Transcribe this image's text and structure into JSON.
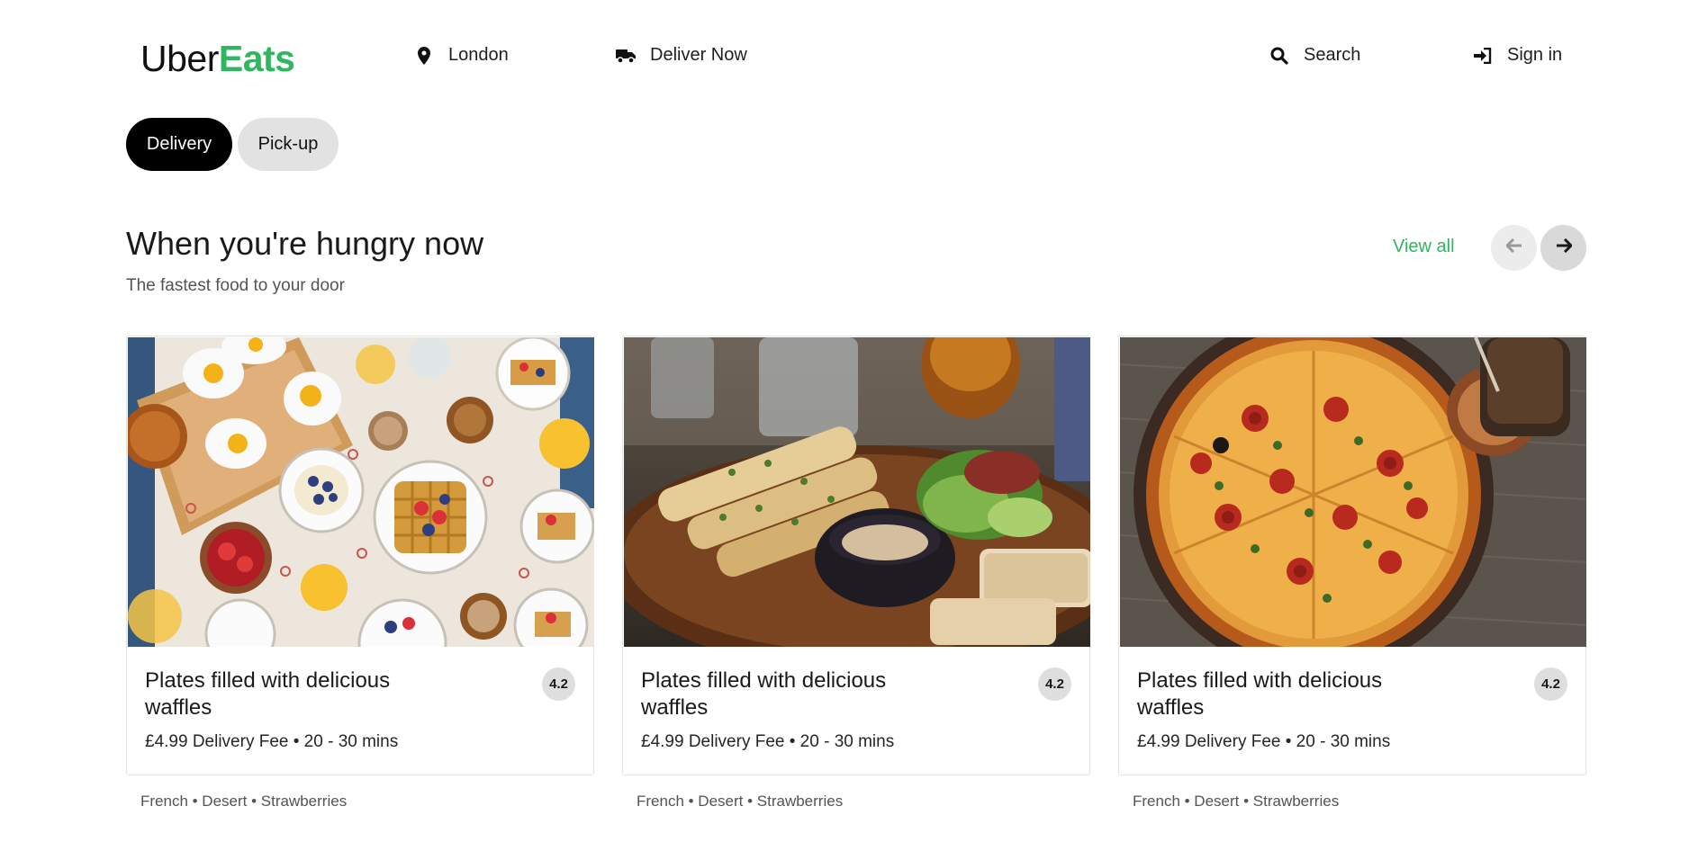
{
  "brand": {
    "part1": "Uber",
    "part2": "Eats",
    "accent_color": "#2fb65f"
  },
  "nav": {
    "location": {
      "label": "London",
      "icon": "map-pin-icon"
    },
    "deliver": {
      "label": "Deliver Now",
      "icon": "truck-icon"
    },
    "search": {
      "label": "Search",
      "icon": "search-icon"
    },
    "signin": {
      "label": "Sign in",
      "icon": "sign-in-icon"
    }
  },
  "toggle": {
    "delivery": "Delivery",
    "pickup": "Pick-up",
    "selected": "Delivery"
  },
  "section": {
    "title": "When you're hungry now",
    "subtitle": "The fastest food to your door",
    "view_all": "View all",
    "prev_icon": "arrow-left-icon",
    "next_icon": "arrow-right-icon"
  },
  "cards": [
    {
      "image": "waffles-breakfast-table-photo",
      "title": "Plates filled with delicious waffles",
      "rating": "4.2",
      "meta": "£4.99 Delivery Fee • 20 - 30 mins",
      "tags": "French • Desert • Strawberries"
    },
    {
      "image": "grilled-fish-plate-photo",
      "title": "Plates filled with delicious waffles",
      "rating": "4.2",
      "meta": "£4.99 Delivery Fee • 20 - 30 mins",
      "tags": "French • Desert • Strawberries"
    },
    {
      "image": "pepperoni-pizza-photo",
      "title": "Plates filled with delicious waffles",
      "rating": "4.2",
      "meta": "£4.99 Delivery Fee • 20 - 30 mins",
      "tags": "French • Desert • Strawberries"
    }
  ]
}
